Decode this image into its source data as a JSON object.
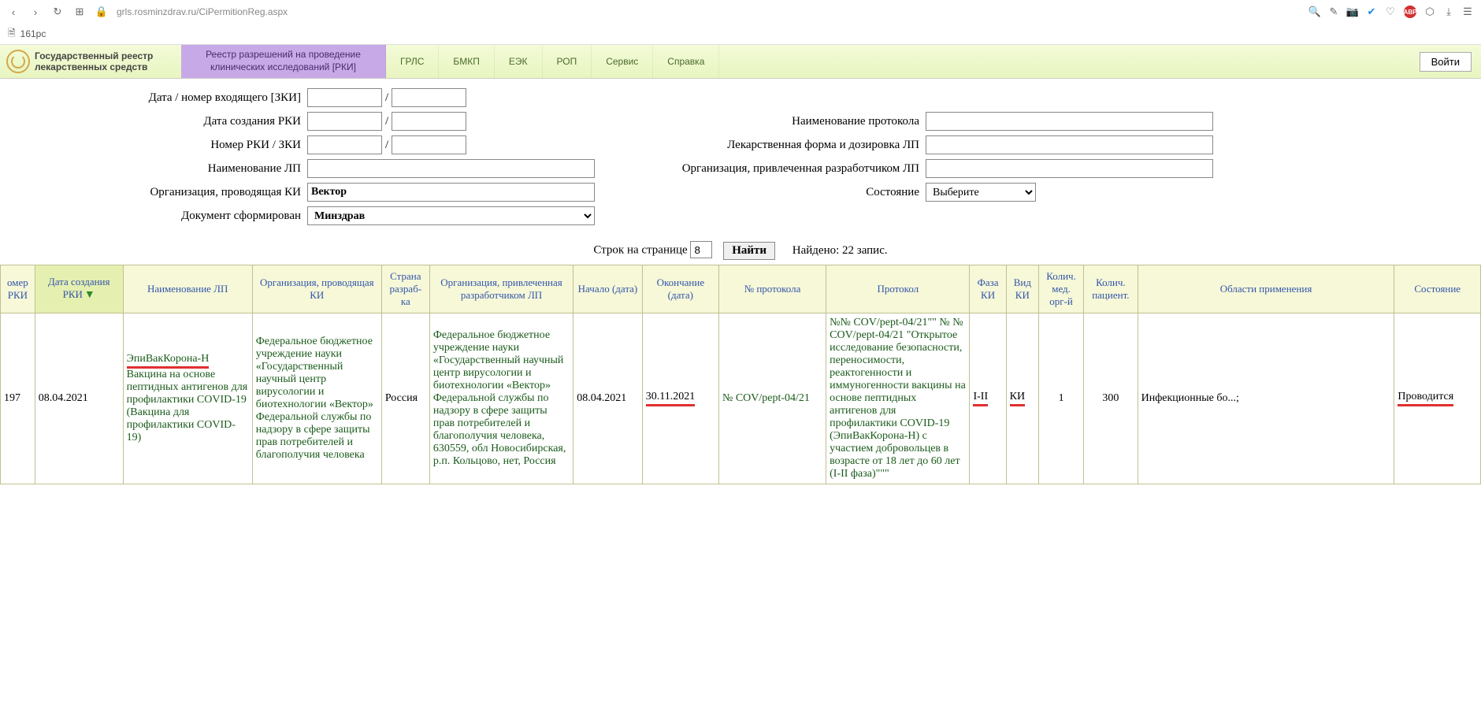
{
  "browser": {
    "url": "grls.rosminzdrav.ru/CiPermitionReg.aspx",
    "tab_title": "161pc"
  },
  "header": {
    "site_title_line1": "Государственный реестр",
    "site_title_line2": "лекарственных средств",
    "nav": {
      "active": "Реестр разрешений на проведение клинических исследований [РКИ]",
      "items": [
        "ГРЛС",
        "БМКП",
        "ЕЭК",
        "РОП",
        "Сервис",
        "Справка"
      ]
    },
    "login": "Войти"
  },
  "form": {
    "labels": {
      "zki_date_num": "Дата / номер входящего [ЗКИ]",
      "rki_create_date": "Дата создания РКИ",
      "rki_zki_num": "Номер РКИ / ЗКИ",
      "lp_name": "Наименование ЛП",
      "org_ki": "Организация, проводящая КИ",
      "doc_formed": "Документ сформирован",
      "protocol_name": "Наименование протокола",
      "lek_form": "Лекарственная форма и дозировка ЛП",
      "org_dev": "Организация, привлеченная разработчиком ЛП",
      "state": "Состояние"
    },
    "values": {
      "org_ki": "Вектор",
      "doc_formed": "Минздрав",
      "state": "Выберите"
    }
  },
  "pager": {
    "rows_label": "Строк на странице",
    "rows_value": "8",
    "find": "Найти",
    "found": "Найдено: 22 запис."
  },
  "table": {
    "headers": {
      "col1": "омер\nРКИ",
      "col2": "Дата создания РКИ",
      "col3": "Наименование ЛП",
      "col4": "Организация, проводящая КИ",
      "col5": "Страна разраб-ка",
      "col6": "Организация, привлеченная разработчиком ЛП",
      "col7": "Начало (дата)",
      "col8": "Окончание (дата)",
      "col9": "№ протокола",
      "col10": "Протокол",
      "col11": "Фаза КИ",
      "col12": "Вид КИ",
      "col13": "Колич. мед. орг-й",
      "col14": "Колич. пациент.",
      "col15": "Области применения",
      "col16": "Состояние"
    },
    "row": {
      "num": "197",
      "date": "08.04.2021",
      "lp_title": "ЭпиВакКорона-Н",
      "lp_desc": "Вакцина на основе пептидных антигенов для профилактики COVID-19 (Вакцина для профилактики COVID-19)",
      "org_ki": "Федеральное бюджетное учреждение науки «Государственный научный центр вирусологии и биотехнологии «Вектор» Федеральной службы по надзору в сфере защиты прав потребителей и благополучия человека",
      "country": "Россия",
      "org_dev": "Федеральное бюджетное учреждение науки «Государственный научный центр вирусологии и биотехнологии «Вектор» Федеральной службы по надзору в сфере защиты прав потребителей и благополучия человека, 630559, обл Новосибирская, р.п. Кольцово, нет, Россия",
      "start": "08.04.2021",
      "end": "30.11.2021",
      "protocol_num": "№ COV/pept-04/21",
      "protocol": "№№ COV/pept-04/21\"\" № № COV/pept-04/21 \"Открытое исследование безопасности, переносимости, реактогенности и иммуногенности вакцины на основе пептидных антигенов для профилактики COVID-19 (ЭпиВакКорона-Н) с участием добровольцев в возрасте от 18 лет до 60 лет (I-II фаза)\"\"\"",
      "phase": "I-II",
      "type": "КИ",
      "org_count": "1",
      "patient_count": "300",
      "area": "Инфекционные бо...;",
      "state": "Проводится"
    }
  }
}
